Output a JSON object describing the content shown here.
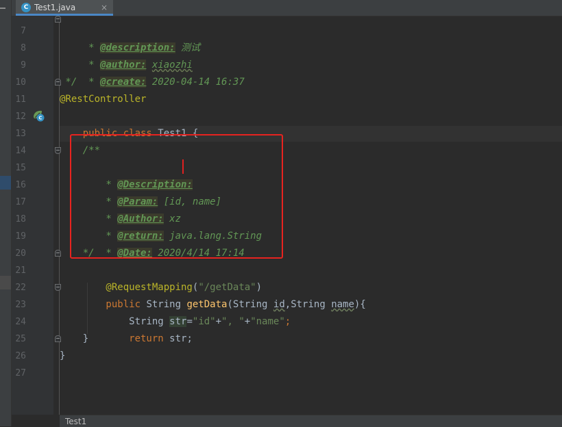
{
  "tab": {
    "icon_letter": "C",
    "label": "Test1.java",
    "close": "×"
  },
  "breadcrumb": "Test1",
  "lines": [
    "7",
    "8",
    "9",
    "10",
    "11",
    "12",
    "13",
    "14",
    "15",
    "16",
    "17",
    "18",
    "19",
    "20",
    "21",
    "22",
    "23",
    "24",
    "25",
    "26",
    "27"
  ],
  "code": {
    "l7": {
      "pre": " * ",
      "tag": "@description:",
      "val": " 测试"
    },
    "l8": {
      "pre": " * ",
      "tag": "@author:",
      "val": "xiaozhi"
    },
    "l9": {
      "pre": " * ",
      "tag": "@create:",
      "val": " 2020-04-14 16:37"
    },
    "l10": " */",
    "l11": "@RestController",
    "l12": {
      "kw": "public class",
      "rest": " Test1 {"
    },
    "l14": "    /**",
    "l15": {
      "pre": "    * ",
      "tag": "@Description:"
    },
    "l16": {
      "pre": "    * ",
      "tag": "@Param:",
      "val": " [id, name]"
    },
    "l17": {
      "pre": "    * ",
      "tag": "@Author:",
      "val": " xz"
    },
    "l18": {
      "pre": "    * ",
      "tag": "@return:",
      "val": " java.lang.String"
    },
    "l19": {
      "pre": "    * ",
      "tag": "@Date:",
      "val": " 2020/4/14 17:14"
    },
    "l20": "    */",
    "l21": {
      "ann": "    @RequestMapping",
      "p1": "(",
      "str": "\"/getData\"",
      "p2": ")"
    },
    "l22": {
      "kw": "    public",
      "t1": " String ",
      "fn": "getData",
      "t2": "(String ",
      "id": "id",
      "t3": ",String ",
      "name": "name",
      "t4": "){"
    },
    "l23": {
      "t1": "        String ",
      "var": "str",
      "t2": "=",
      "s1": "\"id\"",
      "t3": "+",
      "s2": "\", \"",
      "t4": "+",
      "s3": "\"name\"",
      "t5": ";"
    },
    "l24": {
      "kw": "        return",
      "rest": " str;"
    },
    "l25": "    }",
    "l26": "}"
  },
  "colors": {
    "keyword": "#cc7832",
    "doc": "#629755",
    "annotation": "#bbb529",
    "string": "#6a8759",
    "method": "#ffc66d",
    "highlight_box": "#e8231f"
  }
}
